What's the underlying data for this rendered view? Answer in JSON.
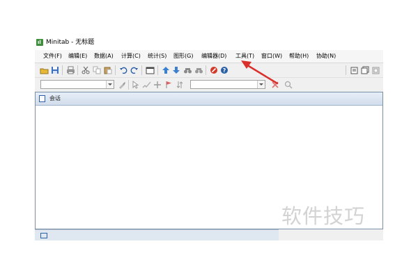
{
  "window": {
    "title": "Minitab - 无标题",
    "icon": "minitab-icon"
  },
  "menu": [
    "文件(F)",
    "编辑(E)",
    "数据(A)",
    "计算(C)",
    "统计(S)",
    "图形(G)",
    "编辑器(D)",
    "工具(T)",
    "窗口(W)",
    "帮助(H)",
    "协助(N)"
  ],
  "toolbar1": {
    "icons": [
      "open-icon",
      "save-icon",
      "print-icon",
      "cut-icon",
      "copy-icon",
      "paste-icon",
      "undo-icon",
      "redo-icon",
      "window-icon",
      "up-arrow-icon",
      "down-arrow-icon",
      "find-icon",
      "find-next-icon",
      "cancel-icon",
      "help-icon",
      "session-icon",
      "worksheet-icon",
      "project-icon"
    ]
  },
  "toolbar2": {
    "combo1_value": "",
    "combo2_value": "",
    "icons": [
      "brush-icon",
      "select-icon",
      "edit-icon",
      "crosshair-icon",
      "flag-icon",
      "sort-icon",
      "delete-icon",
      "zoom-icon"
    ]
  },
  "session": {
    "title": "会话"
  },
  "watermark": "软件技巧",
  "colors": {
    "annotation_arrow": "#d9302c",
    "app_icon": "#3f8f3f",
    "help_blue": "#2a5fa8"
  }
}
